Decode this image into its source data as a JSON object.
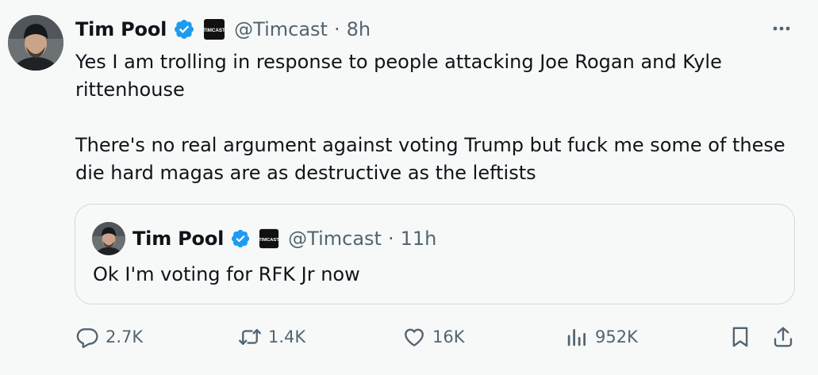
{
  "tweet": {
    "display_name": "Tim Pool",
    "badge_icon": "verified-badge-icon",
    "affiliation_icon": "timcast-affiliate-logo",
    "affiliation_logo_text": "TIMCAST",
    "handle": "@Timcast",
    "separator": "·",
    "time": "8h",
    "body": {
      "paragraph_1_line_1": "Yes I am trolling in response to people attacking Joe Rogan and Kyle",
      "paragraph_1_line_2": "rittenhouse",
      "paragraph_2_line_1": "There's no real argument against voting Trump but fuck me some of these",
      "paragraph_2_line_2": "die hard magas are as destructive as the leftists"
    }
  },
  "quote": {
    "display_name": "Tim Pool",
    "handle": "@Timcast",
    "separator": "·",
    "time": "11h",
    "body": "Ok I'm voting for RFK Jr now"
  },
  "actions": {
    "reply": {
      "icon": "reply-icon",
      "count": "2.7K"
    },
    "repost": {
      "icon": "repost-icon",
      "count": "1.4K"
    },
    "like": {
      "icon": "heart-icon",
      "count": "16K"
    },
    "views": {
      "icon": "views-bar-icon",
      "count": "952K"
    },
    "bookmark": {
      "icon": "bookmark-icon"
    },
    "share": {
      "icon": "share-icon"
    }
  },
  "colors": {
    "background": "#f7f9f9",
    "text": "#0f1419",
    "secondary_text": "#536471",
    "verified_blue": "#1d9bf0",
    "border": "#cfd9de"
  }
}
